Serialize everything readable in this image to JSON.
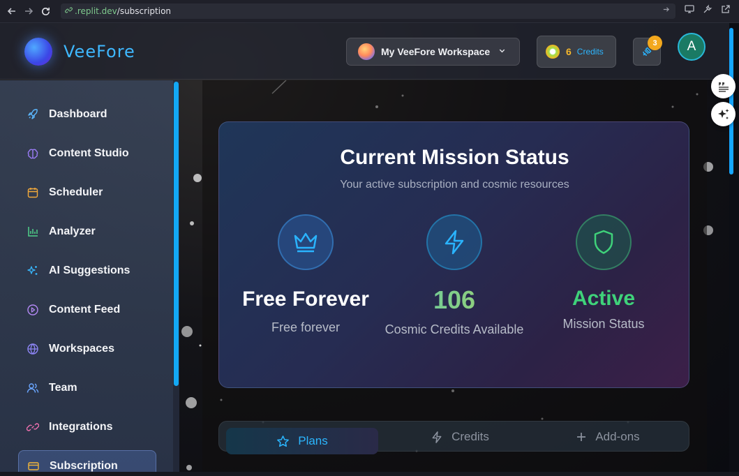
{
  "browser": {
    "url_host": ".replit.dev",
    "url_path": "/subscription"
  },
  "header": {
    "logo_text": "VeeFore",
    "workspace_label": "My VeeFore Workspace",
    "credits_count": "6",
    "credits_label": "Credits",
    "notification_count": "3",
    "avatar_initial": "A"
  },
  "sidebar": {
    "items": [
      {
        "label": "Dashboard",
        "icon": "rocket-icon"
      },
      {
        "label": "Content Studio",
        "icon": "brain-icon"
      },
      {
        "label": "Scheduler",
        "icon": "calendar-icon"
      },
      {
        "label": "Analyzer",
        "icon": "bar-chart-icon"
      },
      {
        "label": "AI Suggestions",
        "icon": "sparkles-icon"
      },
      {
        "label": "Content Feed",
        "icon": "play-circle-icon"
      },
      {
        "label": "Workspaces",
        "icon": "globe-icon"
      },
      {
        "label": "Team",
        "icon": "users-icon"
      },
      {
        "label": "Integrations",
        "icon": "link-icon"
      },
      {
        "label": "Subscription",
        "icon": "credit-card-icon",
        "active": true
      }
    ]
  },
  "status": {
    "title": "Current Mission Status",
    "subtitle": "Your active subscription and cosmic resources",
    "plan_value": "Free Forever",
    "plan_label": "Free forever",
    "credits_value": "106",
    "credits_label": "Cosmic Credits Available",
    "mission_value": "Active",
    "mission_label": "Mission Status"
  },
  "tabs": {
    "plans": "Plans",
    "credits": "Credits",
    "addons": "Add-ons"
  },
  "colors": {
    "accent": "#2bb6ff",
    "credits_gold": "#f5b72b",
    "active_green": "#3fd27a"
  }
}
